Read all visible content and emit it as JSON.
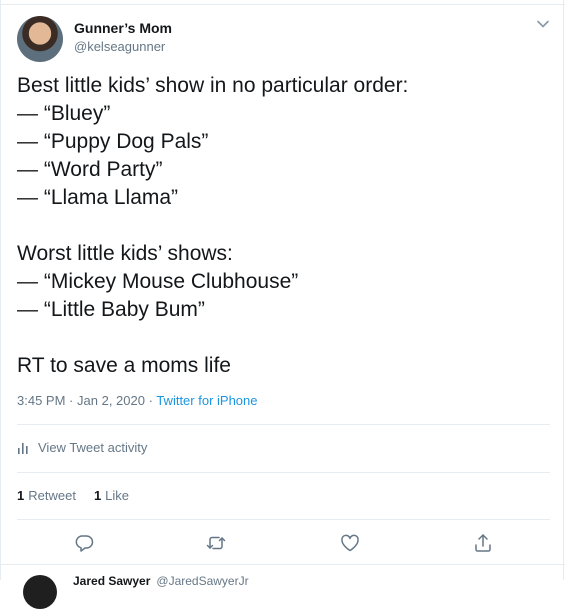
{
  "author": {
    "name": "Gunner’s Mom",
    "handle": "@kelseagunner"
  },
  "tweet": {
    "text": "Best little kids’ show in no particular order:\n— “Bluey”\n— “Puppy Dog Pals”\n— “Word Party”\n— “Llama Llama”\n\nWorst little kids’ shows:\n— “Mickey Mouse Clubhouse”\n— “Little Baby Bum”\n\nRT to save a moms life",
    "time": "3:45 PM",
    "date": "Jan 2, 2020",
    "separator": "·",
    "source": "Twitter for iPhone"
  },
  "activity_label": "View Tweet activity",
  "stats": {
    "retweet_count": "1",
    "retweet_label": "Retweet",
    "like_count": "1",
    "like_label": "Like"
  },
  "actions": [
    "reply-icon",
    "retweet-icon",
    "like-icon",
    "share-icon"
  ],
  "icons": {
    "caret": "chevron-down-icon",
    "activity": "bar-chart-icon"
  },
  "colors": {
    "text": "#14171a",
    "secondary": "#657786",
    "link": "#1b95e0",
    "border": "#e6ecf0"
  },
  "next_tweet": {
    "name": "Jared Sawyer",
    "handle": "@JaredSawyerJr"
  }
}
